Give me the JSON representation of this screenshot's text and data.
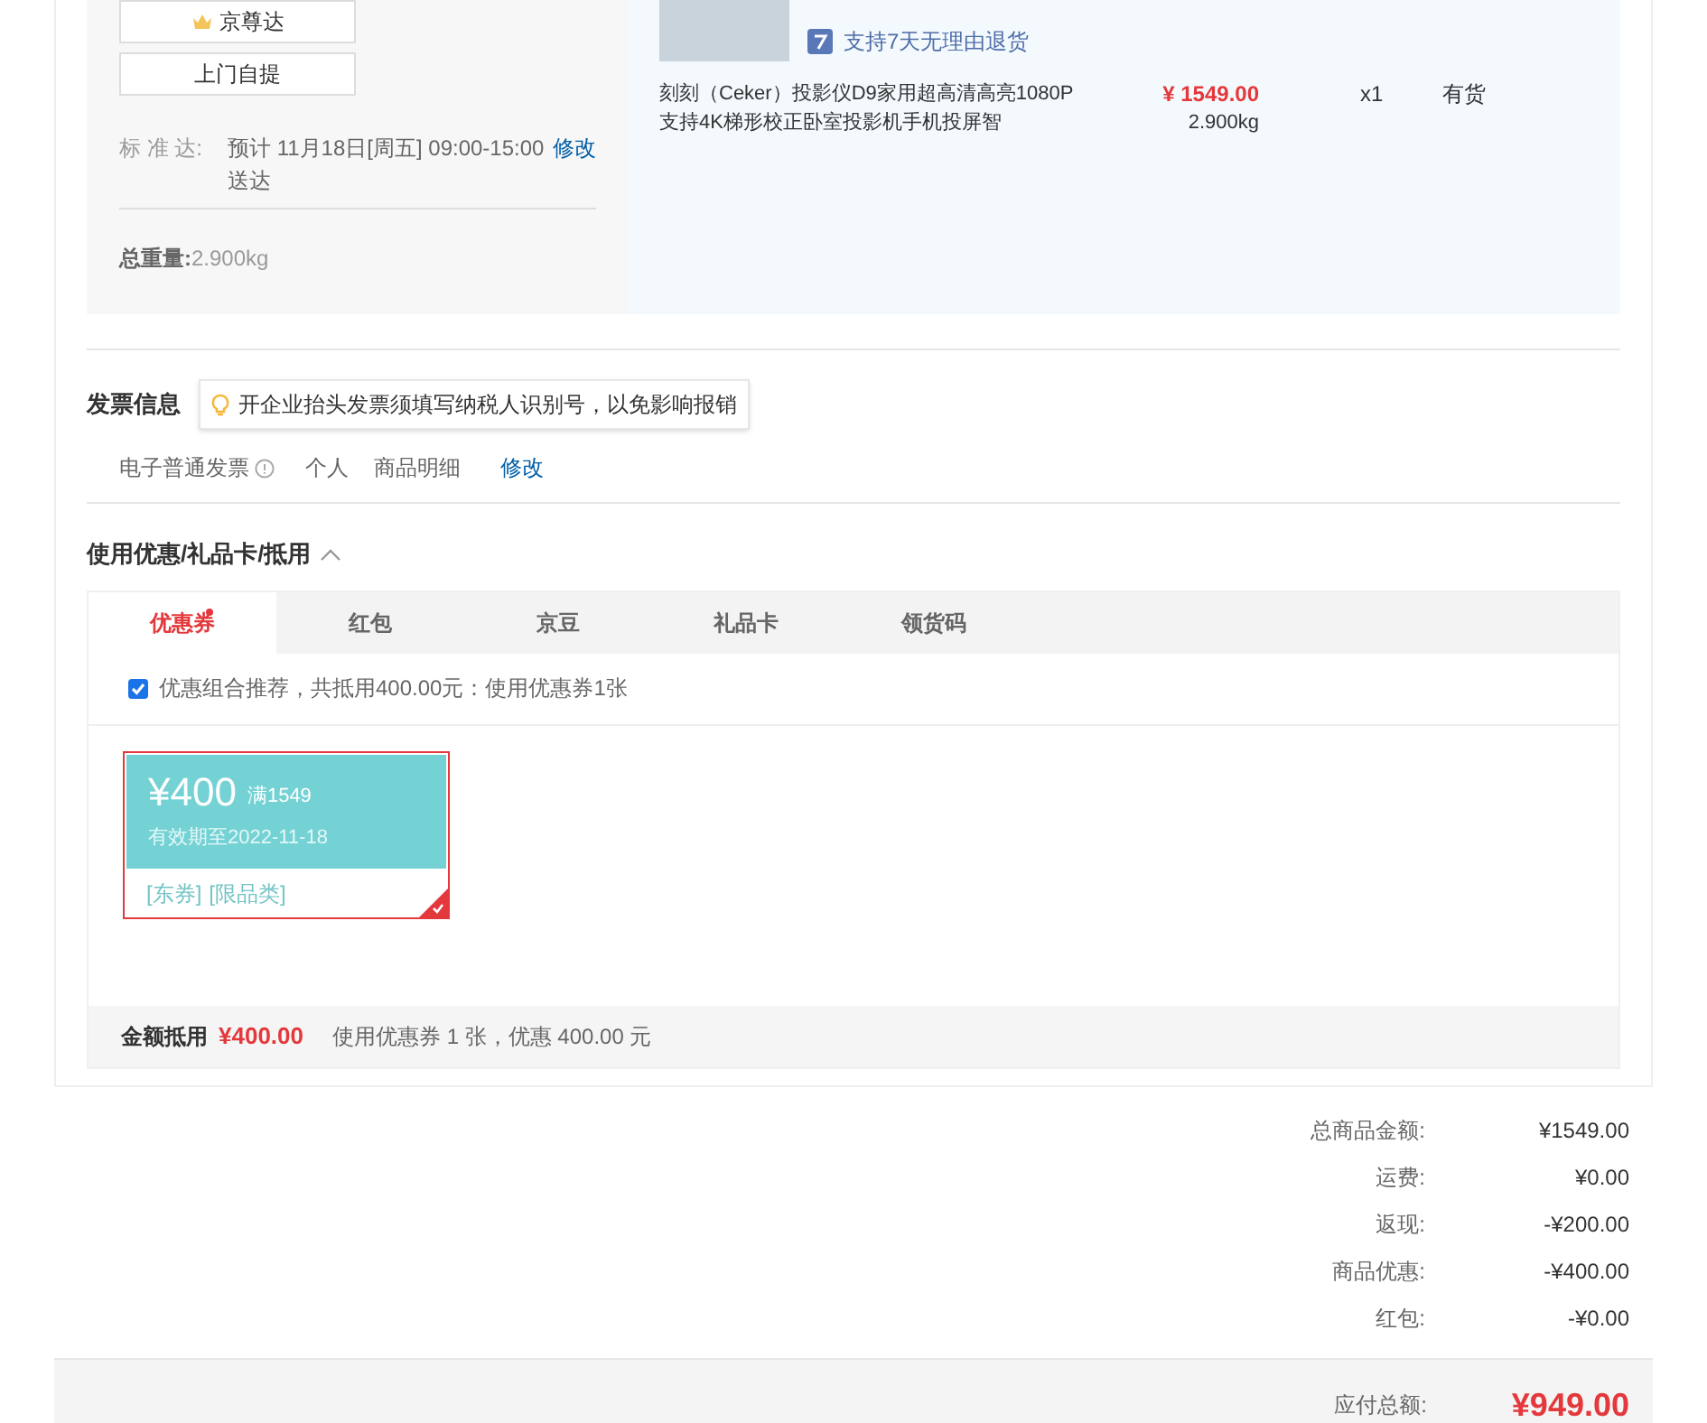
{
  "shipping": {
    "options": [
      {
        "label": "京尊达",
        "kind": "crown"
      },
      {
        "label": "上门自提",
        "kind": "plain"
      }
    ],
    "standard": {
      "label": "标 准 达:",
      "value": "预计 11月18日[周五] 09:00-15:00 送达",
      "edit": "修改"
    },
    "weight": {
      "label": "总重量:",
      "value": "2.900kg"
    }
  },
  "product": {
    "return_policy": "支持7天无理由退货",
    "name": "刻刻（Ceker）投影仪D9家用超高清高亮1080P支持4K梯形校正卧室投影机手机投屏智",
    "price": "¥ 1549.00",
    "weight": "2.900kg",
    "quantity": "x1",
    "stock": "有货"
  },
  "invoice": {
    "title": "发票信息",
    "tip": "开企业抬头发票须填写纳税人识别号，以免影响报销",
    "type": "电子普通发票",
    "holder": "个人",
    "content": "商品明细",
    "edit": "修改"
  },
  "discounts": {
    "title": "使用优惠/礼品卡/抵用",
    "expanded": true,
    "tabs": [
      {
        "label": "优惠券",
        "selected": true,
        "dot": true
      },
      {
        "label": "红包",
        "selected": false,
        "dot": false
      },
      {
        "label": "京豆",
        "selected": false,
        "dot": false
      },
      {
        "label": "礼品卡",
        "selected": false,
        "dot": false
      },
      {
        "label": "领货码",
        "selected": false,
        "dot": false
      }
    ],
    "recommend": {
      "checked": true,
      "text": "优惠组合推荐，共抵用400.00元：使用优惠券1张"
    },
    "coupons": [
      {
        "amount": "¥400",
        "condition": "满1549",
        "expiry": "有效期至2022-11-18",
        "tags": [
          "[东券]",
          "[限品类]"
        ],
        "selected": true
      }
    ],
    "summary": {
      "label": "金额抵用",
      "amount": "¥400.00",
      "text": "使用优惠券 1 张，优惠 400.00 元"
    }
  },
  "totals": {
    "rows": [
      {
        "label": "总商品金额:",
        "value": "¥1549.00"
      },
      {
        "label": "运费:",
        "value": "¥0.00"
      },
      {
        "label": "返现:",
        "value": "-¥200.00"
      },
      {
        "label": "商品优惠:",
        "value": "-¥400.00"
      },
      {
        "label": "红包:",
        "value": "-¥0.00"
      }
    ],
    "payable": {
      "label": "应付总额:",
      "value": "¥949.00"
    }
  }
}
